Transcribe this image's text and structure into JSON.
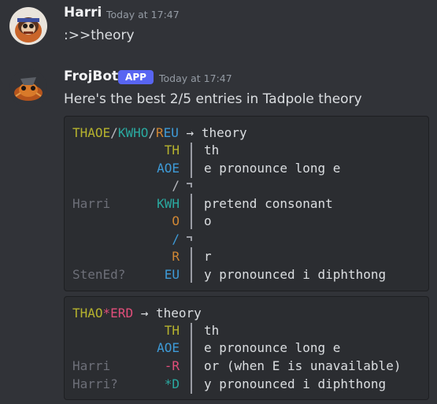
{
  "message1": {
    "username": "Harri",
    "timestamp": "Today at 17:47",
    "text": ":>>theory"
  },
  "message2": {
    "username": "FrojBot",
    "badge": "APP",
    "timestamp": "Today at 17:47",
    "text": "Here's the best 2/5 entries in Tadpole theory"
  },
  "entry1": {
    "outline": {
      "p1": "THAOE",
      "s1": "/",
      "p2": "KWHO",
      "s2": "/",
      "p3a": "R",
      "p3b": "EU",
      "arrow": "→",
      "word": "theory"
    },
    "rows": [
      {
        "author": "",
        "stroke": "TH",
        "desc": "th"
      },
      {
        "author": "",
        "stroke": "AOE",
        "desc": "e pronounce long e"
      },
      {
        "author": "",
        "stroke": "/",
        "desc": ""
      },
      {
        "author": "Harri",
        "stroke": "KWH",
        "desc": "pretend consonant"
      },
      {
        "author": "",
        "stroke": "O",
        "desc": "o"
      },
      {
        "author": "",
        "stroke": "/",
        "desc": ""
      },
      {
        "author": "",
        "stroke": "R",
        "desc": "r"
      },
      {
        "author": "StenEd?",
        "stroke": "EU",
        "desc": "y pronounced i diphthong"
      }
    ]
  },
  "entry2": {
    "outline": {
      "p1": "THAO",
      "star": "*",
      "p2": "ERD",
      "arrow": "→",
      "word": "theory"
    },
    "rows": [
      {
        "author": "",
        "stroke": "TH",
        "desc": "th"
      },
      {
        "author": "",
        "stroke": "AOE",
        "desc": "e pronounce long e"
      },
      {
        "author": "Harri",
        "stroke": "-R",
        "desc": "or (when E is unavailable)"
      },
      {
        "author": "Harri?",
        "stroke": "*D",
        "desc": "y pronounced i diphthong"
      }
    ]
  }
}
